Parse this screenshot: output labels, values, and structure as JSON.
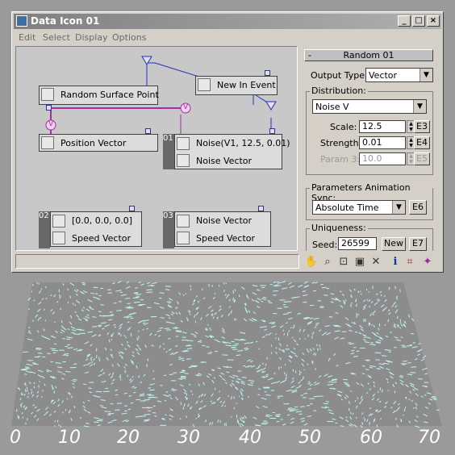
{
  "window": {
    "title": "Data Icon 01",
    "controls": {
      "minimize": "_",
      "maximize": "□",
      "close": "×"
    }
  },
  "menu": [
    "Edit",
    "Select",
    "Display",
    "Options"
  ],
  "nodes": {
    "random_surface_point": "Random Surface Point",
    "new_in_event": "New In Event",
    "position_vector": "Position Vector",
    "noise_top": "Noise(V1, 12.5, 0.01)",
    "noise_bottom": "Noise Vector",
    "vec_top": "[0.0, 0.0, 0.0]",
    "vec_bottom": "Speed Vector",
    "noisevec_top": "Noise Vector",
    "noisevec_bottom": "Speed Vector",
    "v_label": "V",
    "num_01": "01",
    "num_02": "02",
    "num_03": "03"
  },
  "panel": {
    "rollout_title": "Random 01",
    "rollout_toggle": "-",
    "output_type_label": "Output Type:",
    "output_type_value": "Vector",
    "distribution_label": "Distribution:",
    "distribution_value": "Noise V",
    "scale_label": "Scale:",
    "scale_value": "12.5",
    "scale_btn": "E3",
    "strength_label": "Strength:",
    "strength_value": "0.01",
    "strength_btn": "E4",
    "param3_label": "Param 3:",
    "param3_value": "10.0",
    "param3_btn": "E5",
    "sync_label": "Parameters Animation Sync:",
    "sync_value": "Absolute Time",
    "sync_btn": "E6",
    "uniqueness_label": "Uniqueness:",
    "seed_label": "Seed:",
    "seed_value": "26599",
    "new_btn": "New",
    "seed_btn": "E7"
  },
  "toolbar_icons": [
    "hand-icon",
    "zoom-icon",
    "zoom-region-icon",
    "zoom-extents-icon",
    "delete-icon",
    "info-icon",
    "wiring-icon",
    "color-icon"
  ],
  "axis_ticks": [
    "0",
    "10",
    "20",
    "30",
    "40",
    "50",
    "60",
    "70"
  ],
  "colors": {
    "title_bar": "#808080",
    "wire_purple": "#a030a0",
    "wire_blue": "#2030c0",
    "particles": "#bff7ee"
  }
}
